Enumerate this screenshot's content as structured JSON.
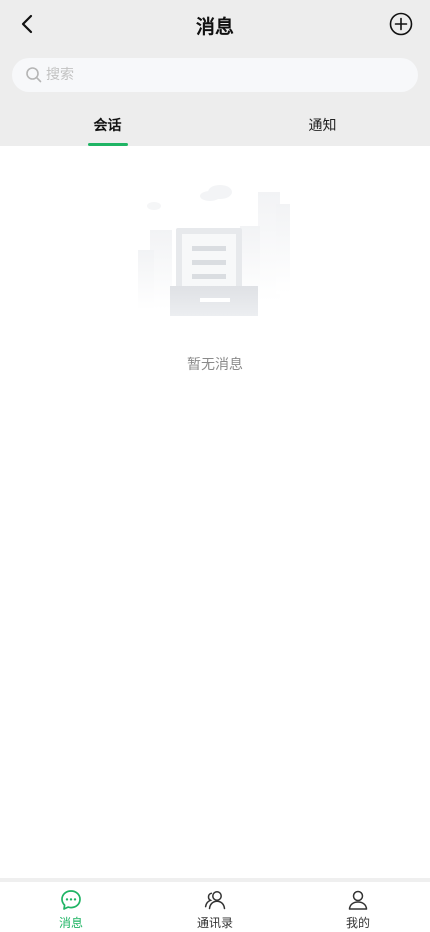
{
  "header": {
    "title": "消息",
    "back_icon": "chevron-left-icon",
    "add_icon": "plus-circle-icon"
  },
  "search": {
    "placeholder": "搜索",
    "value": ""
  },
  "tabs": [
    {
      "label": "会话",
      "active": true
    },
    {
      "label": "通知",
      "active": false
    }
  ],
  "empty_state": {
    "text": "暂无消息",
    "icon": "empty-inbox-icon"
  },
  "bottom_nav": [
    {
      "label": "消息",
      "icon": "chat-bubble-icon",
      "active": true
    },
    {
      "label": "通讯录",
      "icon": "contacts-icon",
      "active": false
    },
    {
      "label": "我的",
      "icon": "user-icon",
      "active": false
    }
  ],
  "colors": {
    "accent": "#1fb464",
    "header_bg": "#ededed",
    "search_bg": "#f7f8fa",
    "empty_text": "#8a8a8a"
  }
}
